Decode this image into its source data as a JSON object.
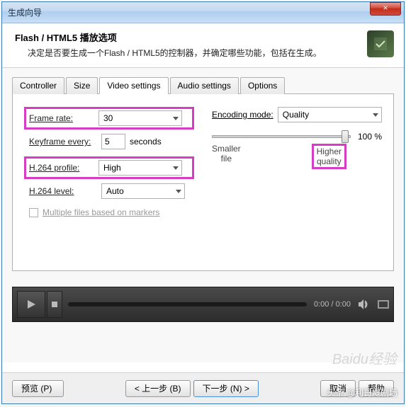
{
  "window": {
    "title": "生成向导",
    "close": "×"
  },
  "header": {
    "title": "Flash / HTML5 播放选项",
    "desc": "决定是否要生成一个Flash / HTML5的控制器，并确定哪些功能，包括在生成。"
  },
  "tabs": {
    "controller": "Controller",
    "size": "Size",
    "video": "Video settings",
    "audio": "Audio settings",
    "options": "Options"
  },
  "video": {
    "frame_rate_label": "Frame rate:",
    "frame_rate_value": "30",
    "keyframe_label": "Keyframe every:",
    "keyframe_value": "5",
    "keyframe_unit": "seconds",
    "profile_label": "H.264 profile:",
    "profile_value": "High",
    "level_label": "H.264 level:",
    "level_value": "Auto",
    "multi_files": "Multiple files based on markers",
    "encoding_label": "Encoding mode:",
    "encoding_value": "Quality",
    "quality_pct": "100 %",
    "smaller": "Smaller\nfile",
    "higher": "Higher\nquality"
  },
  "player": {
    "time": "0:00  /  0:00"
  },
  "footer": {
    "preview": "预览 (P)",
    "prev": "< 上一步 (B)",
    "next": "下一步 (N) >",
    "cancel": "取消",
    "help": "帮助"
  },
  "watermark": "Baidu经验",
  "credit": "头条 @利哥飕剧场"
}
